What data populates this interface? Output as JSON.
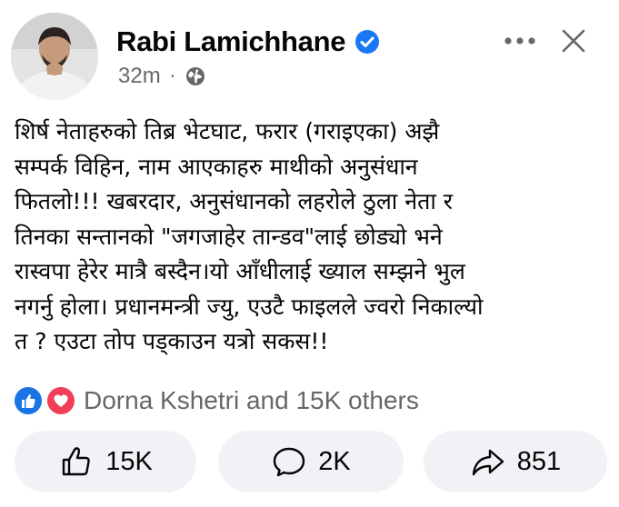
{
  "post": {
    "author": {
      "name": "Rabi Lamichhane",
      "verified": true
    },
    "timestamp": "32m",
    "privacy_icon": "globe-icon",
    "lines": [
      "शिर्ष नेताहरुको तिब्र भेटघाट, फरार (गराइएका) अझै",
      "सम्पर्क विहिन, नाम आएकाहरु माथीको अनुसंधान",
      "फितलो!!! खबरदार,  अनुसंधानको लहरोले ठुला नेता र",
      "तिनका  सन्तानको \"जगजाहेर  तान्डव\"लाई छोड्यो भने",
      "रास्वपा हेरेर मात्रै बस्दैन।यो आँधीलाई ख्याल सम्झने भुल",
      "नगर्नु होला। प्रधानमन्त्री ज्यु, एउटै फाइलले ज्वरो निकाल्यो",
      "त ? एउटा तोप पड्काउन यत्रो सकस!!"
    ],
    "reactions": {
      "icons": [
        "like-icon",
        "love-icon"
      ],
      "summary": "Dorna Kshetri and 15K others"
    },
    "actions": {
      "like_count": "15K",
      "comment_count": "2K",
      "share_count": "851"
    }
  },
  "colors": {
    "verified_blue": "#1877f2",
    "like_blue": "#1b74e4",
    "love_red": "#f33e58",
    "secondary_text": "#65676b",
    "button_bg": "#f0f2f5"
  }
}
